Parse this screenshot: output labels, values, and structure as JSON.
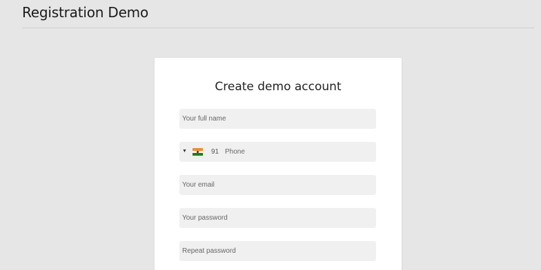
{
  "page": {
    "title": "Registration Demo"
  },
  "form": {
    "title": "Create demo account",
    "full_name": {
      "value": "",
      "placeholder": "Your full name"
    },
    "phone": {
      "country_flag": "india-flag-icon",
      "dial_code": "91",
      "value": "",
      "placeholder": "Phone"
    },
    "email": {
      "value": "",
      "placeholder": "Your email"
    },
    "password": {
      "value": "",
      "placeholder": "Your password"
    },
    "repeat_password": {
      "value": "",
      "placeholder": "Repeat password"
    }
  },
  "colors": {
    "page_background": "#e6e6e6",
    "card_background": "#ffffff",
    "field_background": "#f0f0f0"
  }
}
